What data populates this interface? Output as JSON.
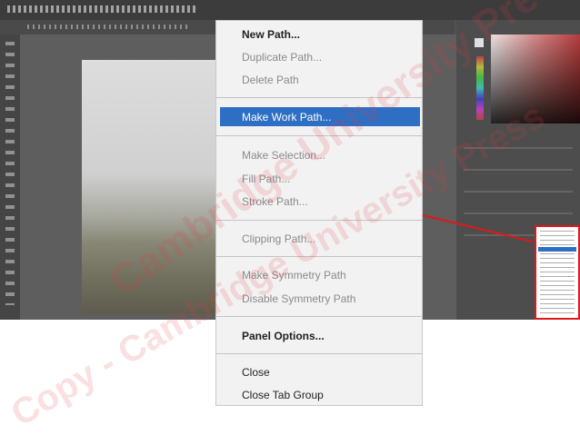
{
  "context_menu": {
    "items": [
      {
        "label": "New Path...",
        "state": "enabled"
      },
      {
        "label": "Duplicate Path...",
        "state": "disabled"
      },
      {
        "label": "Delete Path",
        "state": "disabled"
      },
      {
        "label": "Make Work Path...",
        "state": "highlighted"
      },
      {
        "label": "Make Selection...",
        "state": "disabled"
      },
      {
        "label": "Fill Path...",
        "state": "disabled"
      },
      {
        "label": "Stroke Path...",
        "state": "disabled"
      },
      {
        "label": "Clipping Path...",
        "state": "disabled"
      },
      {
        "label": "Make Symmetry Path",
        "state": "disabled"
      },
      {
        "label": "Disable Symmetry Path",
        "state": "disabled"
      },
      {
        "label": "Panel Options...",
        "state": "enabled"
      },
      {
        "label": "Close",
        "state": "enabled"
      },
      {
        "label": "Close Tab Group",
        "state": "enabled"
      }
    ]
  },
  "watermark": {
    "text_1": "Cambridge University Press",
    "text_2": "Copy - Cambridge University Press"
  },
  "colors": {
    "highlight": "#2e6fc4",
    "callout": "#e01818",
    "app_background": "#535353",
    "menu_background": "#f2f2f2"
  }
}
